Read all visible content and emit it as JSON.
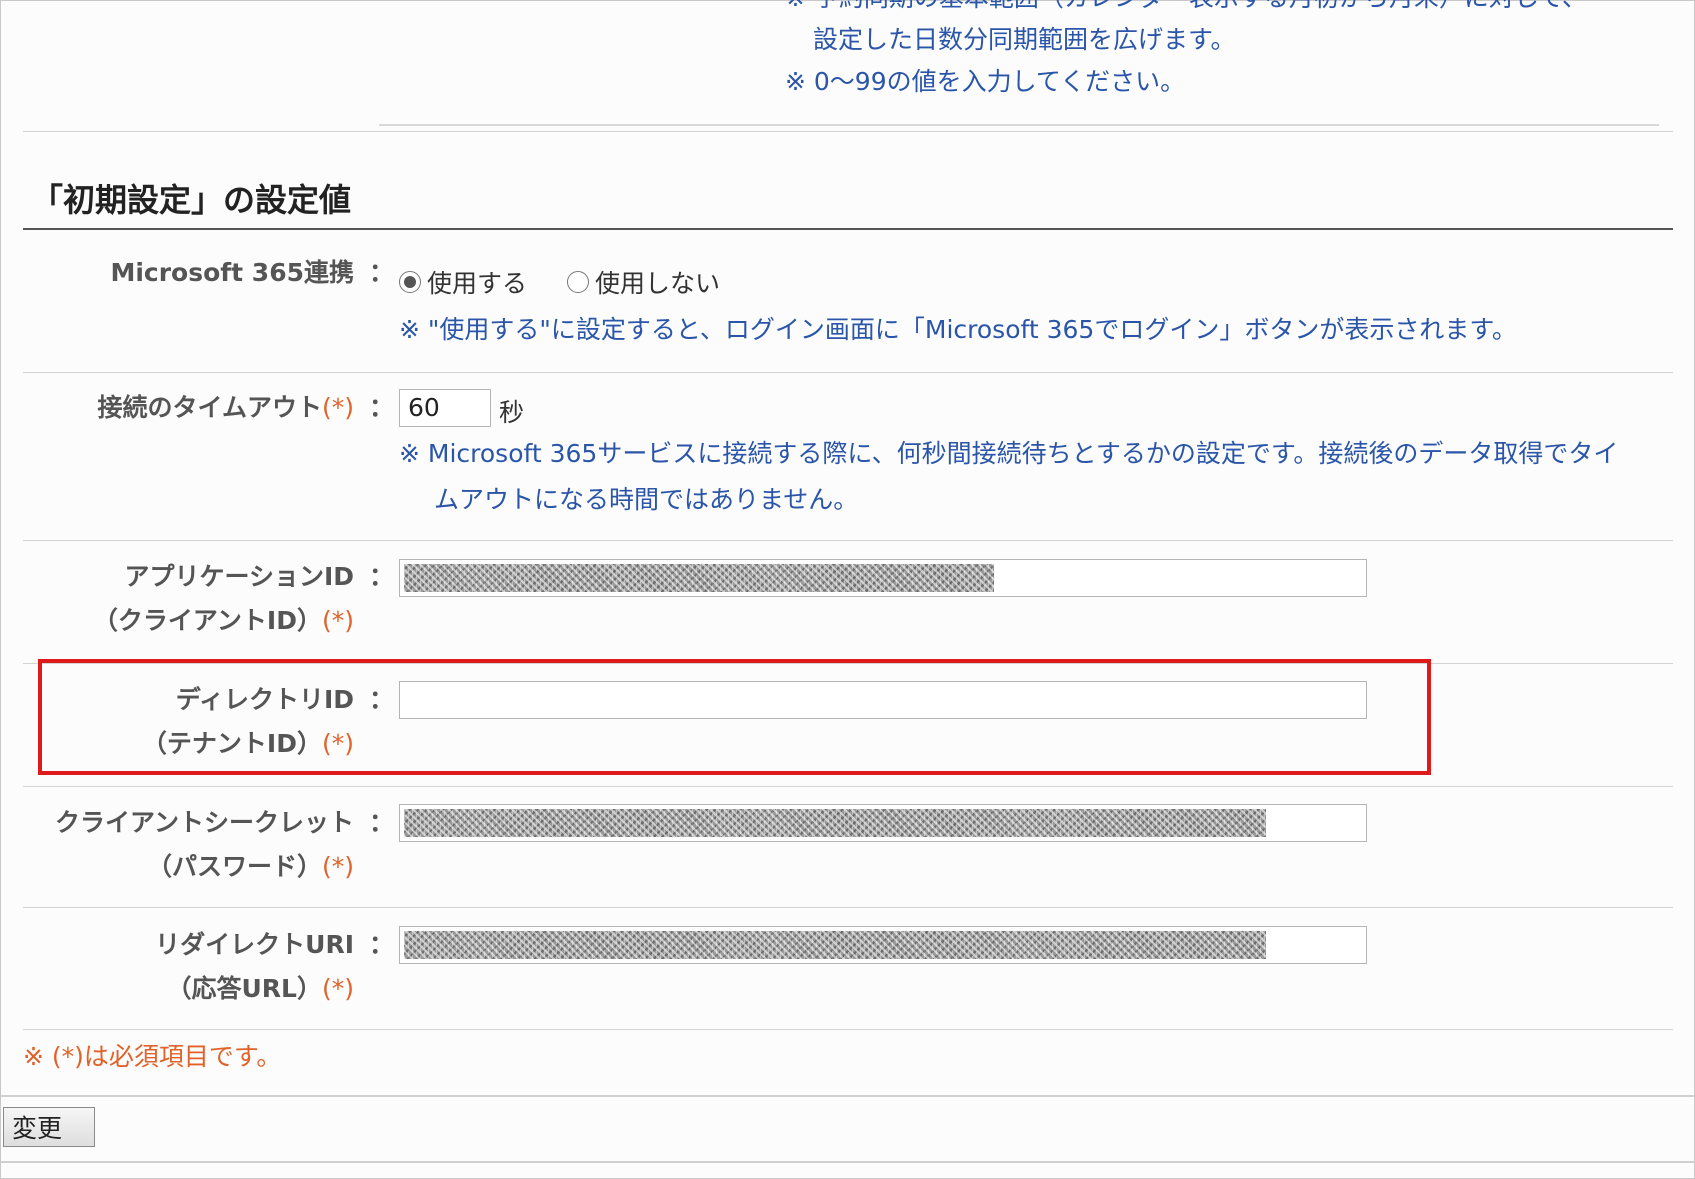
{
  "top_notes": {
    "line_partial": "※ 予約同期の基本範囲（カレンダー表示する月初から月末）に対して、",
    "line1": "設定した日数分同期範囲を広げます。",
    "line2": "※ 0〜99の値を入力してください。"
  },
  "section": {
    "title": "「初期設定」の設定値"
  },
  "ms365_link": {
    "label": "Microsoft 365連携",
    "colon": "：",
    "options": [
      "使用する",
      "使用しない"
    ],
    "selected": "使用する",
    "note": "※ \"使用する\"に設定すると、ログイン画面に「Microsoft 365でログイン」ボタンが表示されます。"
  },
  "timeout": {
    "label": "接続のタイムアウト",
    "required_mark": "(*)",
    "colon": "：",
    "value": "60",
    "unit": "秒",
    "note_line1": "※ Microsoft 365サービスに接続する際に、何秒間接続待ちとするかの設定です。接続後のデータ取得でタイ",
    "note_line2": "ムアウトになる時間ではありません。"
  },
  "application_id": {
    "label_line1": "アプリケーションID",
    "label_line2": "（クライアントID）",
    "required_mark": "(*)",
    "colon": "："
  },
  "directory_id": {
    "label_line1": "ディレクトリID",
    "label_line2": "（テナントID）",
    "required_mark": "(*)",
    "colon": "：",
    "value": ""
  },
  "client_secret": {
    "label_line1": "クライアントシークレット",
    "label_line2": "（パスワード）",
    "required_mark": "(*)",
    "colon": "："
  },
  "redirect_uri": {
    "label_line1": "リダイレクトURI",
    "label_line2": "（応答URL）",
    "required_mark": "(*)",
    "colon": "："
  },
  "required_note": "※ (*)は必須項目です。",
  "submit_label": "変更",
  "colors": {
    "note_blue": "#2a55a8",
    "required_orange": "#e0622a",
    "highlight_red": "#e01a1a"
  }
}
